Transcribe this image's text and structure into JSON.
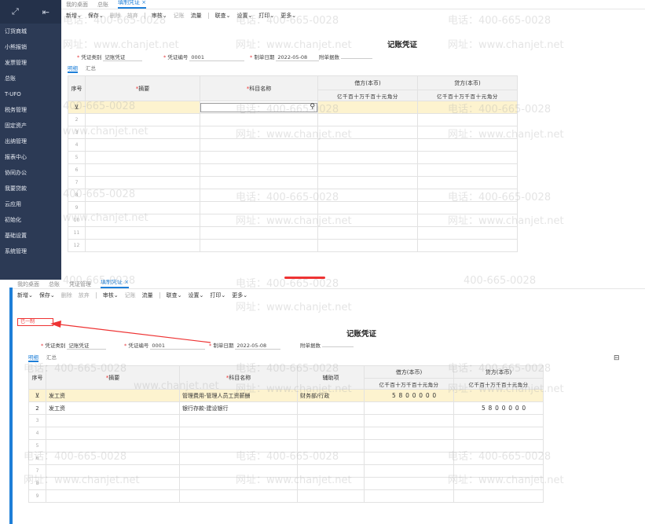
{
  "screen1": {
    "sidebar": [
      "订货商城",
      "小熊报销",
      "发票管理",
      "总账",
      "T-UFO",
      "税务管理",
      "固定资产",
      "出纳管理",
      "报表中心",
      "协同办公",
      "我要贷款",
      "云应用",
      "初始化",
      "基础设置",
      "系统管理"
    ],
    "tabs": [
      "我的桌面",
      "总账",
      "填制凭证"
    ],
    "toolbar": [
      "新增",
      "保存",
      "删除",
      "放弃",
      "审核",
      "记账",
      "流量",
      "联查",
      "设置",
      "打印",
      "更多"
    ],
    "voucher_title": "记账凭证",
    "voucher_type_label": "凭证类别",
    "voucher_type_value": "记账凭证",
    "voucher_no_label": "凭证编号",
    "voucher_no_value": "0001",
    "date_label": "制单日期",
    "date_value": "2022-05-08",
    "attach_label": "附单据数",
    "subtabs": [
      "明细",
      "汇总"
    ],
    "headers": {
      "seq": "序号",
      "summary": "摘要",
      "account": "科目名称",
      "debit": "借方(本币)",
      "credit": "贷方(本币)"
    },
    "digits": [
      "亿",
      "千",
      "百",
      "十",
      "万",
      "千",
      "百",
      "十",
      "元",
      "角",
      "分"
    ],
    "rows": [
      "",
      "2",
      "3",
      "4",
      "5",
      "6",
      "7",
      "8",
      "9",
      "10",
      "11",
      "12"
    ]
  },
  "screen2": {
    "tabs": [
      "我的桌面",
      "总账",
      "凭证管理",
      "填制凭证"
    ],
    "toolbar": [
      "新增",
      "保存",
      "删除",
      "放弃",
      "审核",
      "记账",
      "流量",
      "联查",
      "设置",
      "打印",
      "更多"
    ],
    "badge": "已一制",
    "voucher_title": "记账凭证",
    "voucher_type_label": "凭证类别",
    "voucher_type_value": "记账凭证",
    "voucher_no_label": "凭证编号",
    "voucher_no_value": "0001",
    "date_label": "制单日期",
    "date_value": "2022-05-08",
    "attach_label": "附单据数",
    "subtabs": [
      "明细",
      "汇总"
    ],
    "headers": {
      "seq": "序号",
      "summary": "摘要",
      "account": "科目名称",
      "aux": "辅助项",
      "debit": "借方(本币)",
      "credit": "贷方(本币)"
    },
    "digits": [
      "亿",
      "千",
      "百",
      "十",
      "万",
      "千",
      "百",
      "十",
      "元",
      "角",
      "分"
    ],
    "rows": [
      {
        "seq": "",
        "summary": "发工资",
        "account": "管理费用-管理人员工资薪酬",
        "aux": "财务部/行政",
        "debit": "5800000",
        "credit": ""
      },
      {
        "seq": "2",
        "summary": "发工资",
        "account": "银行存款-建设银行",
        "aux": "",
        "debit": "",
        "credit": "5800000"
      },
      {
        "seq": "3",
        "summary": "",
        "account": "",
        "aux": "",
        "debit": "",
        "credit": ""
      },
      {
        "seq": "4",
        "summary": "",
        "account": "",
        "aux": "",
        "debit": "",
        "credit": ""
      },
      {
        "seq": "5",
        "summary": "",
        "account": "",
        "aux": "",
        "debit": "",
        "credit": ""
      },
      {
        "seq": "6",
        "summary": "",
        "account": "",
        "aux": "",
        "debit": "",
        "credit": ""
      },
      {
        "seq": "7",
        "summary": "",
        "account": "",
        "aux": "",
        "debit": "",
        "credit": ""
      },
      {
        "seq": "8",
        "summary": "",
        "account": "",
        "aux": "",
        "debit": "",
        "credit": ""
      },
      {
        "seq": "9",
        "summary": "",
        "account": "",
        "aux": "",
        "debit": "",
        "credit": ""
      }
    ]
  },
  "watermark": {
    "phone": "电话：400-665-0028",
    "site": "网址：www.chanjet.net",
    "phone_short": "400-665-0028",
    "site_short": "www.chanjet.net"
  },
  "colors": {
    "sidebar": "#2c3a55",
    "accent": "#1e7fd8",
    "highlight": "#fdf3cf",
    "arrow": "#e33"
  }
}
